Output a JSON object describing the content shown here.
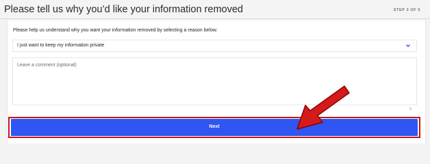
{
  "header": {
    "title": "Please tell us why you’d like your information removed",
    "step": "STEP 3 OF 5"
  },
  "form": {
    "instruction": "Please help us understand why you want your information removed by selecting a reason below.",
    "reason_select": {
      "value": "I just want to keep my information private"
    },
    "comment": {
      "placeholder": "Leave a comment (optional)",
      "count": "0"
    },
    "next_label": "Next"
  },
  "icons": {
    "select": "chevron-down-icon",
    "annotation": "red-arrow-annotation"
  },
  "colors": {
    "accent": "#2f55f2",
    "highlight": "#c4121a"
  }
}
